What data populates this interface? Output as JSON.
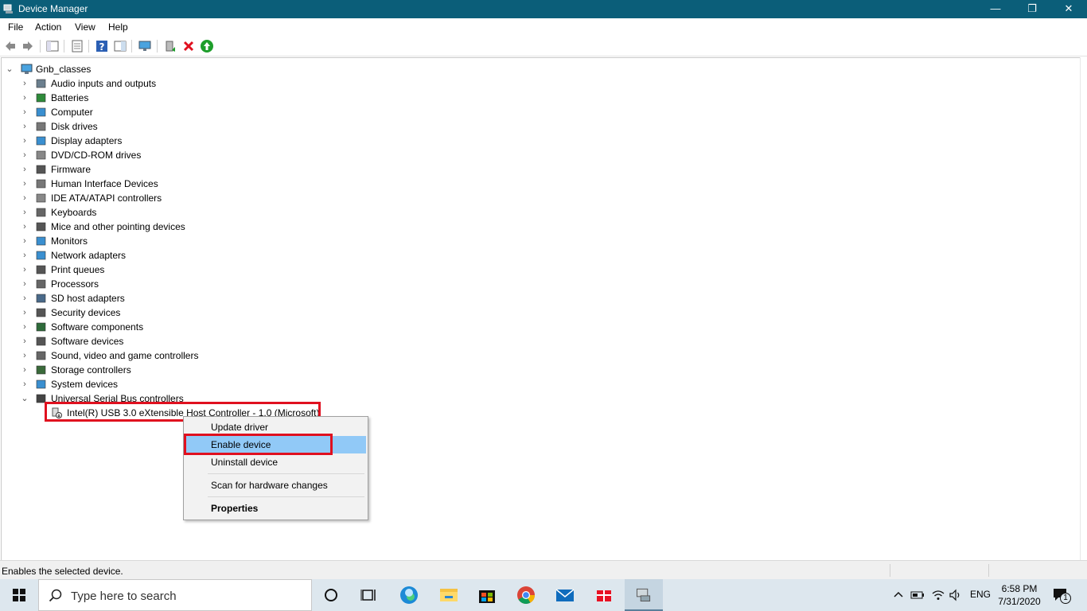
{
  "window": {
    "title": "Device Manager",
    "minimize_glyph": "—",
    "maximize_glyph": "❐",
    "close_glyph": "✕"
  },
  "menu": [
    "File",
    "Action",
    "View",
    "Help"
  ],
  "toolbar": {
    "icons": [
      "back-arrow-icon",
      "forward-arrow-icon",
      "show-hide-tree-icon",
      "properties-icon",
      "help-icon",
      "action-pane-icon",
      "monitor-icon",
      "update-driver-icon",
      "uninstall-icon",
      "enable-device-icon"
    ]
  },
  "tree": {
    "root": "Gnb_classes",
    "categories": [
      {
        "label": "Audio inputs and outputs",
        "icon": "speaker-icon"
      },
      {
        "label": "Batteries",
        "icon": "battery-icon"
      },
      {
        "label": "Computer",
        "icon": "computer-icon"
      },
      {
        "label": "Disk drives",
        "icon": "disk-drive-icon"
      },
      {
        "label": "Display adapters",
        "icon": "display-adapter-icon"
      },
      {
        "label": "DVD/CD-ROM drives",
        "icon": "dvd-drive-icon"
      },
      {
        "label": "Firmware",
        "icon": "firmware-icon"
      },
      {
        "label": "Human Interface Devices",
        "icon": "hid-icon"
      },
      {
        "label": "IDE ATA/ATAPI controllers",
        "icon": "ide-controller-icon"
      },
      {
        "label": "Keyboards",
        "icon": "keyboard-icon"
      },
      {
        "label": "Mice and other pointing devices",
        "icon": "mouse-icon"
      },
      {
        "label": "Monitors",
        "icon": "monitor-icon"
      },
      {
        "label": "Network adapters",
        "icon": "network-adapter-icon"
      },
      {
        "label": "Print queues",
        "icon": "printer-icon"
      },
      {
        "label": "Processors",
        "icon": "processor-icon"
      },
      {
        "label": "SD host adapters",
        "icon": "sd-adapter-icon"
      },
      {
        "label": "Security devices",
        "icon": "security-device-icon"
      },
      {
        "label": "Software components",
        "icon": "software-component-icon"
      },
      {
        "label": "Software devices",
        "icon": "software-device-icon"
      },
      {
        "label": "Sound, video and game controllers",
        "icon": "sound-controller-icon"
      },
      {
        "label": "Storage controllers",
        "icon": "storage-controller-icon"
      },
      {
        "label": "System devices",
        "icon": "system-device-icon"
      },
      {
        "label": "Universal Serial Bus controllers",
        "icon": "usb-icon",
        "expanded": true
      }
    ],
    "usb_child": "Intel(R) USB 3.0 eXtensible Host Controller - 1.0 (Microsoft)"
  },
  "context_menu": {
    "items": [
      "Update driver",
      "Enable device",
      "Uninstall device",
      "Scan for hardware changes",
      "Properties"
    ],
    "selected": "Enable device"
  },
  "status": {
    "text": "Enables the selected device."
  },
  "taskbar": {
    "search_placeholder": "Type here to search",
    "apps": [
      "cortana-icon",
      "task-view-icon",
      "edge-icon",
      "file-explorer-icon",
      "store-icon",
      "chrome-icon",
      "mail-icon",
      "gift-icon",
      "device-manager-icon"
    ],
    "language": "ENG",
    "time": "6:58 PM",
    "date": "7/31/2020",
    "notification_count": "1"
  },
  "colors": {
    "titlebar": "#0b5e79",
    "highlight_box": "#e0101f",
    "menu_selected": "#91c9f7",
    "taskbar": "#dde7ee"
  }
}
